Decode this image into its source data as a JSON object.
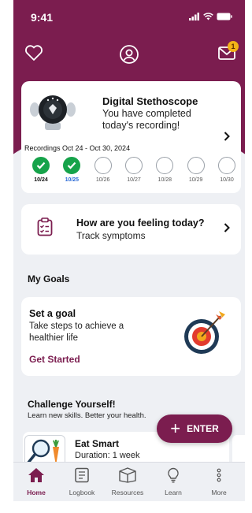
{
  "status": {
    "time": "9:41"
  },
  "header": {
    "mail_badge": "1"
  },
  "stethoscope": {
    "title": "Digital Stethoscope",
    "description": "You have completed today's recording!",
    "range": "Recordings Oct 24 - Oct 30, 2024",
    "days": [
      {
        "label": "10/24",
        "done": true
      },
      {
        "label": "10/25",
        "done": true
      },
      {
        "label": "10/26",
        "done": false
      },
      {
        "label": "10/27",
        "done": false
      },
      {
        "label": "10/28",
        "done": false
      },
      {
        "label": "10/29",
        "done": false
      },
      {
        "label": "10/30",
        "done": false
      }
    ]
  },
  "feeling": {
    "title": "How are you feeling today?",
    "subtitle": "Track symptoms"
  },
  "goals": {
    "section_title": "My Goals",
    "title": "Set a goal",
    "description": "Take steps to achieve a healthier life",
    "cta": "Get Started"
  },
  "challenge": {
    "section_title": "Challenge Yourself!",
    "subtitle": "Learn new skills. Better your health.",
    "card_title": "Eat Smart",
    "card_sub": "Duration: 1 week"
  },
  "fab": {
    "label": "ENTER"
  },
  "tabs": [
    {
      "label": "Home",
      "icon": "home-icon"
    },
    {
      "label": "Logbook",
      "icon": "logbook-icon"
    },
    {
      "label": "Resources",
      "icon": "resources-icon"
    },
    {
      "label": "Learn",
      "icon": "learn-icon"
    },
    {
      "label": "More",
      "icon": "more-icon"
    }
  ],
  "colors": {
    "brand": "#7b1d4f",
    "done": "#16a34a",
    "today": "#2b6ad6",
    "badge": "#f3b318"
  }
}
